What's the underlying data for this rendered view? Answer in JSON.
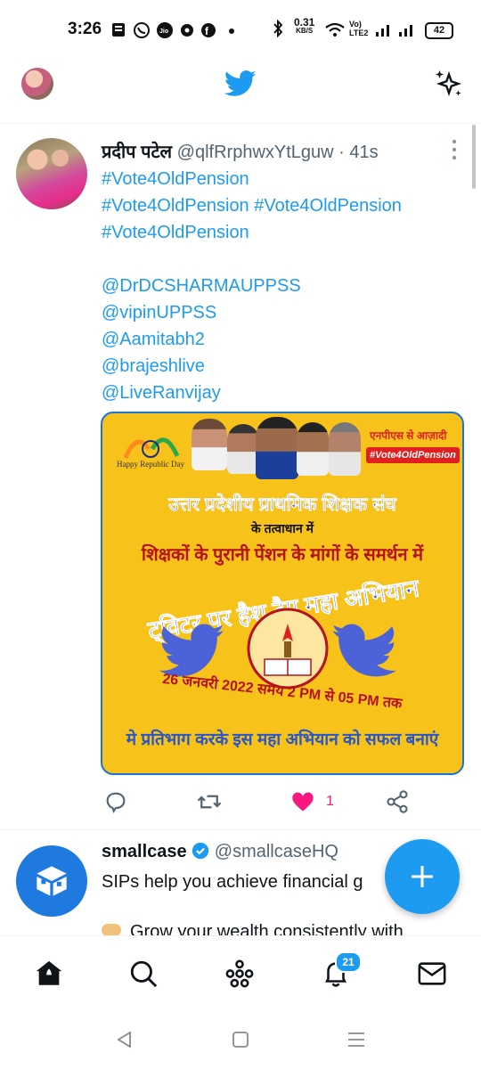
{
  "status_bar": {
    "time": "3:26",
    "data_speed": "0.31",
    "data_unit": "KB/S",
    "volte_top": "Vo)",
    "volte_bottom": "LTE2",
    "battery": "42"
  },
  "header": {
    "logo_icon": "twitter-bird-icon",
    "sparkle_icon": "sparkle-icon"
  },
  "tweet": {
    "name": "प्रदीप पटेल",
    "handle": "@qlfRrphwxYtLguw",
    "dot": "·",
    "time": "41s",
    "lines": [
      "#Vote4OldPension",
      "#Vote4OldPension #Vote4OldPension",
      "#Vote4OldPension",
      "",
      "@DrDCSHARMAUPPSS",
      "@vipinUPPSS",
      "@Aamitabh2",
      "@brajeshlive",
      "@LiveRanvijay"
    ],
    "image": {
      "republic": "Happy Republic Day",
      "badge_top": "एनपीएस से आज़ादी",
      "badge_bottom": "#Vote4OldPension",
      "org": "उत्तर प्रदेशीय प्राथमिक शिक्षक संघ",
      "under": "के तत्वाधान में",
      "support": "शिक्षकों के पुरानी पेंशन के मांगों के समर्थन में",
      "campaign": "ट्विटर पर हैश टैग महा अभियान",
      "date": "26 जनवरी 2022 समय 2 PM से 05 PM तक",
      "cta": "मे प्रतिभाग करके इस महा अभियान को सफल बनाएं"
    },
    "like_count": "1"
  },
  "second_tweet": {
    "name": "smallcase",
    "handle": "@smallcaseHQ",
    "line1": "SIPs help you achieve financial g",
    "line2": "Grow your wealth consistently with"
  },
  "nav": {
    "notifications_badge": "21"
  },
  "colors": {
    "twitter_blue": "#1d9bf0",
    "like_pink": "#f91880",
    "card_yellow": "#f7c31a"
  }
}
